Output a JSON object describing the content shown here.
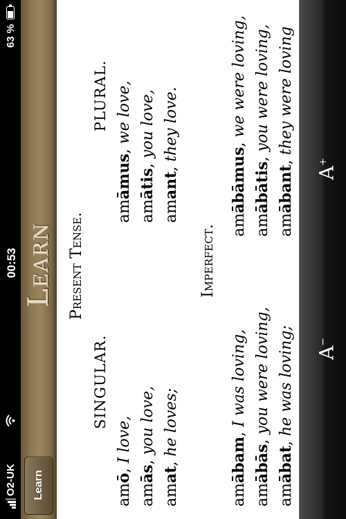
{
  "status_bar": {
    "carrier": "O2-UK",
    "time": "00:53",
    "battery_percent": "63 %"
  },
  "nav": {
    "title": "Learn",
    "back_label": "Learn"
  },
  "lesson": {
    "present_heading": "Present Tense.",
    "singular_heading": "SINGULAR.",
    "plural_heading": "PLURAL.",
    "present_rows": [
      {
        "s_stem": "am",
        "s_end": "ō",
        "s_trans": "I love,",
        "p_stem": "am",
        "p_end": "āmus",
        "p_trans": "we love,"
      },
      {
        "s_stem": "am",
        "s_end": "ās",
        "s_trans": "you love,",
        "p_stem": "am",
        "p_end": "ātis",
        "p_trans": "you love,"
      },
      {
        "s_stem": "am",
        "s_end": "at",
        "s_trans": "he loves;",
        "p_stem": "am",
        "p_end": "ant",
        "p_trans": "they love."
      }
    ],
    "imperfect_heading": "Imperfect.",
    "imperfect_rows": [
      {
        "s_stem": "am",
        "s_end": "ābam",
        "s_trans": "I was loving,",
        "p_stem": "am",
        "p_end": "ābāmus",
        "p_trans": "we were loving,"
      },
      {
        "s_stem": "am",
        "s_end": "ābās",
        "s_trans": "you were loving,",
        "p_stem": "am",
        "p_end": "ābātis",
        "p_trans": "you were loving,"
      },
      {
        "s_stem": "am",
        "s_end": "ābat",
        "s_trans": "he was loving;",
        "p_stem": "am",
        "p_end": "ābant",
        "p_trans": "they were loving"
      }
    ]
  },
  "toolbar": {
    "smaller_label": "A",
    "smaller_mark": "−",
    "larger_label": "A",
    "larger_mark": "+"
  },
  "colors": {
    "nav_wood": "#8e7853",
    "content_bg": "#ffffff",
    "toolbar_bg": "#1e1e1e"
  }
}
